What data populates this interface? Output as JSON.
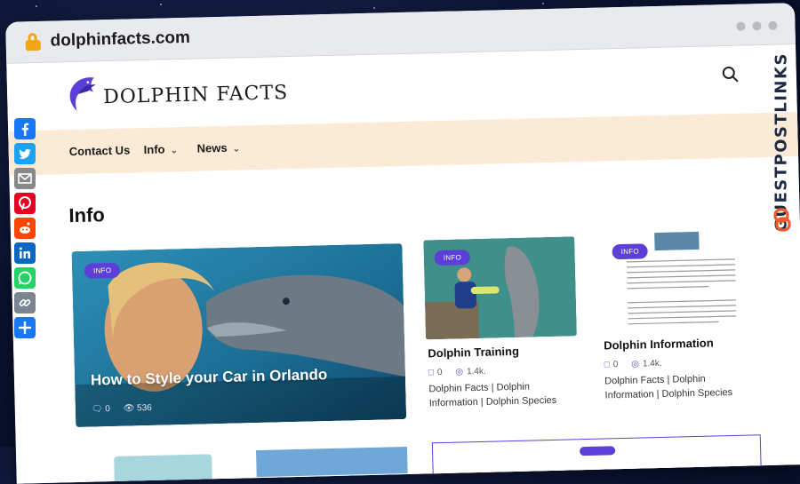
{
  "browser": {
    "url": "dolphinfacts.com"
  },
  "site": {
    "logo_text": "DOLPHIN FACTS",
    "nav": [
      {
        "label": "Contact Us",
        "has_dropdown": false
      },
      {
        "label": "Info",
        "has_dropdown": true
      },
      {
        "label": "News",
        "has_dropdown": true
      }
    ]
  },
  "page": {
    "title": "Info"
  },
  "posts": [
    {
      "badge": "INFO",
      "title": "How to Style your Car in Orlando",
      "comments": "0",
      "views": "536"
    },
    {
      "badge": "INFO",
      "title": "Dolphin Training",
      "comments": "0",
      "views": "1.4k.",
      "categories": "Dolphin Facts | Dolphin Information | Dolphin Species"
    },
    {
      "badge": "INFO",
      "title": "Dolphin Information",
      "comments": "0",
      "views": "1.4k.",
      "categories": "Dolphin Facts | Dolphin Information | Dolphin Species"
    }
  ],
  "share_icons": [
    "facebook-icon",
    "twitter-icon",
    "email-icon",
    "pinterest-icon",
    "reddit-icon",
    "linkedin-icon",
    "whatsapp-icon",
    "copy-link-icon",
    "more-share-icon"
  ],
  "side_brand": {
    "text": "GUESTPOSTLINKS"
  },
  "colors": {
    "accent": "#5b3fd8",
    "nav_bg": "#fbebd6",
    "lock": "#f2a516"
  }
}
